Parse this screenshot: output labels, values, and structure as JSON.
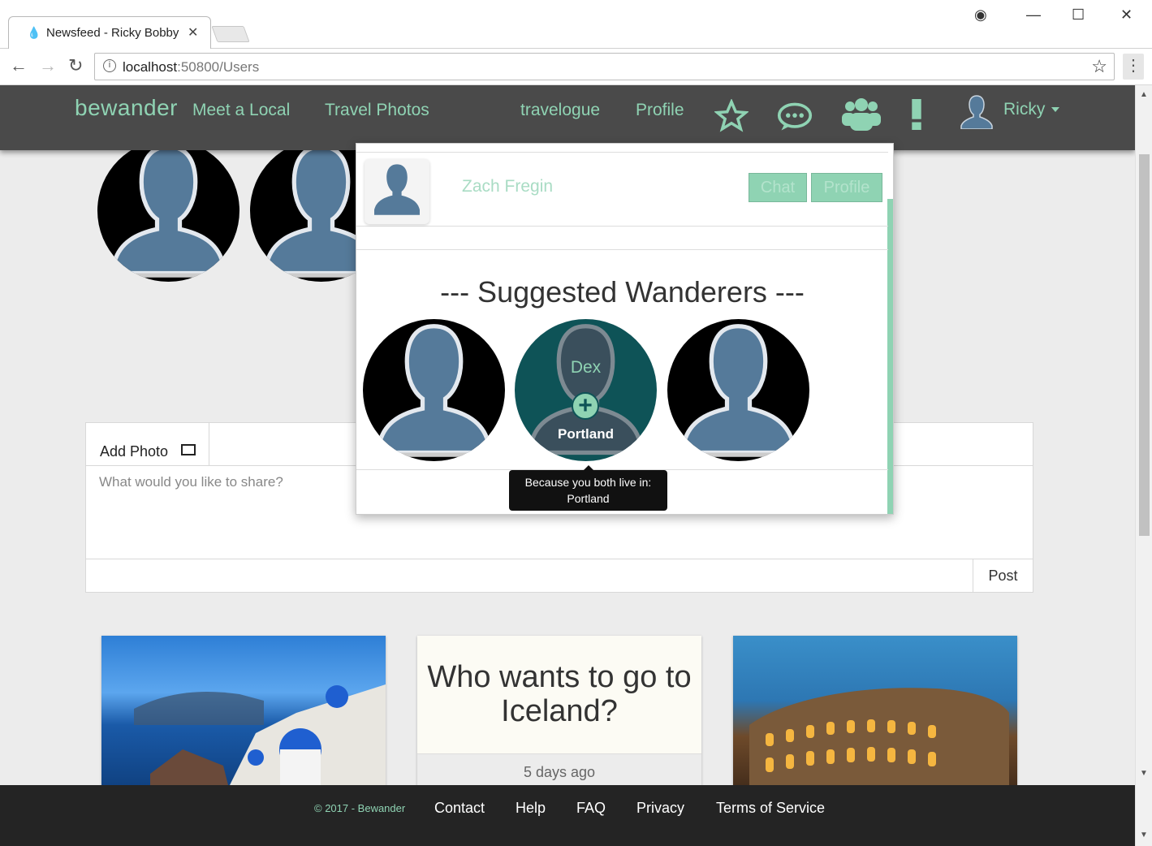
{
  "browser": {
    "tab_title": "Newsfeed - Ricky Bobby",
    "url_host": "localhost",
    "url_path": ":50800/Users"
  },
  "nav": {
    "brand": "bewander",
    "links": [
      "Meet a Local",
      "Travel Photos",
      "travelogue",
      "Profile"
    ],
    "user_name": "Ricky",
    "icons": [
      "star-icon",
      "chat-bubble-icon",
      "group-icon",
      "alert-icon"
    ]
  },
  "panel": {
    "friend_name": "Zach Fregin",
    "chat_label": "Chat",
    "profile_label": "Profile",
    "suggested_title": "--- Suggested Wanderers ---",
    "hover": {
      "name": "Dex",
      "city": "Portland",
      "tooltip_line1": "Because you both live in:",
      "tooltip_line2": "Portland"
    }
  },
  "composer": {
    "add_photo_label": "Add Photo",
    "placeholder": "What would you like to share?",
    "post_label": "Post"
  },
  "cards": {
    "text_card": {
      "question": "Who wants to go to Iceland?",
      "time_ago": "5 days ago"
    }
  },
  "footer": {
    "copyright": "© 2017 - Bewander",
    "links": [
      "Contact",
      "Help",
      "FAQ",
      "Privacy",
      "Terms of Service"
    ]
  },
  "colors": {
    "accent": "#8fd3b3",
    "navbar": "#4a4a4a",
    "footer": "#242424",
    "hover_teal": "#0e5357"
  }
}
